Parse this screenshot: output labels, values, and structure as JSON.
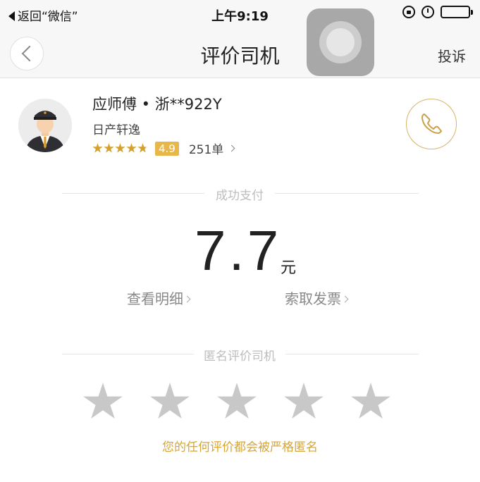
{
  "status_bar": {
    "back_label": "返回“微信”",
    "time": "上午9:19"
  },
  "nav": {
    "title": "评价司机",
    "action": "投诉"
  },
  "driver": {
    "name_plate": "应师傅 • 浙**922Y",
    "car": "日产轩逸",
    "rating": "4.9",
    "rating_stars": 4.9,
    "orders": "251单"
  },
  "payment": {
    "label": "成功支付",
    "amount": "7.7",
    "unit": "元",
    "detail_link": "查看明细",
    "invoice_link": "索取发票"
  },
  "review": {
    "label": "匿名评价司机",
    "stars_selected": 0,
    "stars_total": 5,
    "note": "您的任何评价都会被严格匿名"
  },
  "colors": {
    "accent_gold": "#d6a634",
    "star_gold": "#d4a12c",
    "star_gray": "#c8c8c8",
    "badge_bg": "#e7b74a"
  }
}
